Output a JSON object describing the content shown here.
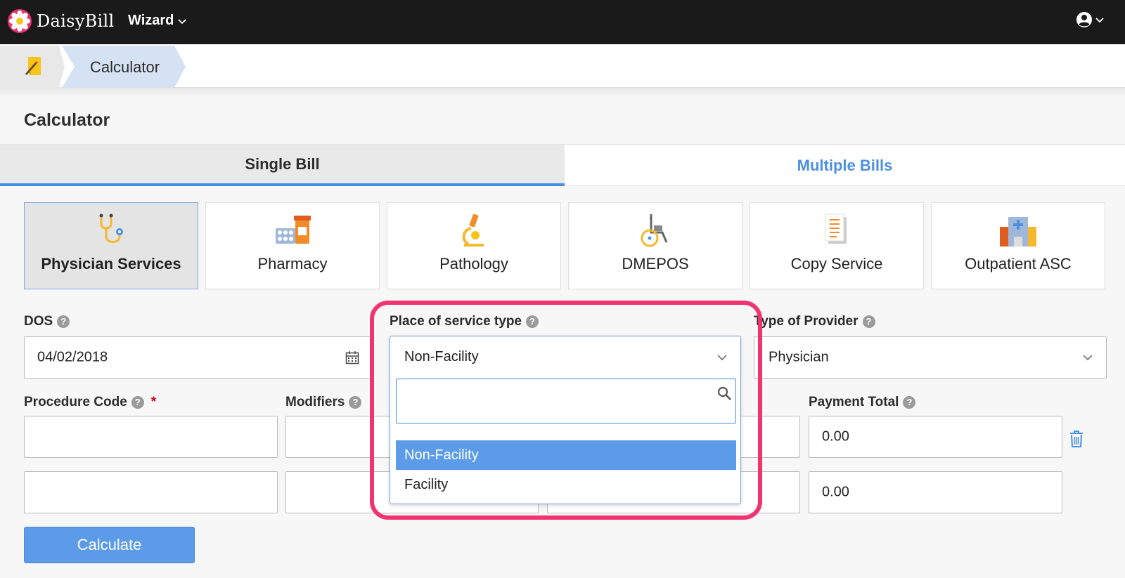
{
  "topbar": {
    "brand": "DaisyBill",
    "wizard_label": "Wizard"
  },
  "breadcrumb": {
    "current": "Calculator"
  },
  "page": {
    "title": "Calculator"
  },
  "tabs": [
    {
      "label": "Single Bill",
      "active": true
    },
    {
      "label": "Multiple Bills",
      "active": false
    }
  ],
  "categories": [
    {
      "label": "Physician Services",
      "icon": "stethoscope-icon",
      "active": true
    },
    {
      "label": "Pharmacy",
      "icon": "pills-icon",
      "active": false
    },
    {
      "label": "Pathology",
      "icon": "microscope-icon",
      "active": false
    },
    {
      "label": "DMEPOS",
      "icon": "wheelchair-icon",
      "active": false
    },
    {
      "label": "Copy Service",
      "icon": "document-icon",
      "active": false
    },
    {
      "label": "Outpatient ASC",
      "icon": "hospital-icon",
      "active": false
    }
  ],
  "form": {
    "dos_label": "DOS",
    "dos_value": "04/02/2018",
    "pos_label": "Place of service type",
    "pos_value": "Non-Facility",
    "provider_label": "Type of Provider",
    "provider_value": "Physician",
    "procedure_label": "Procedure Code",
    "required_mark": "*",
    "modifiers_label": "Modifiers",
    "payment_label": "Payment Total",
    "payment_row1": "0.00",
    "payment_row2": "0.00",
    "help_glyph": "?"
  },
  "dropdown": {
    "selected": "Non-Facility",
    "search_value": "",
    "options": [
      "Non-Facility",
      "Facility"
    ]
  },
  "actions": {
    "calculate": "Calculate"
  },
  "colors": {
    "accent": "#4a90e2",
    "highlight": "#f1336f",
    "topbar": "#1a1a1a"
  }
}
